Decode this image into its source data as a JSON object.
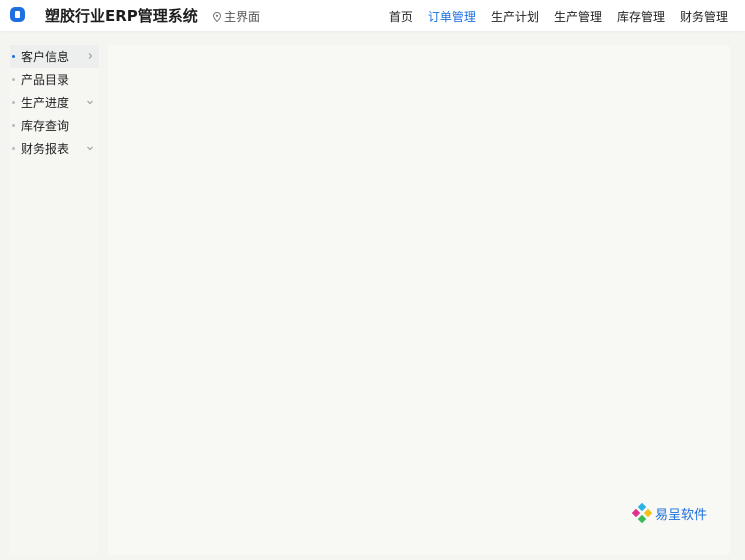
{
  "header": {
    "title": "塑胶行业ERP管理系统",
    "module_label": "主界面",
    "nav": [
      {
        "label": "首页",
        "active": false
      },
      {
        "label": "订单管理",
        "active": true
      },
      {
        "label": "生产计划",
        "active": false
      },
      {
        "label": "生产管理",
        "active": false
      },
      {
        "label": "库存管理",
        "active": false
      },
      {
        "label": "财务管理",
        "active": false
      }
    ]
  },
  "sidebar": {
    "items": [
      {
        "label": "客户信息",
        "active": true,
        "chevron": "chevron-right-icon"
      },
      {
        "label": "产品目录",
        "active": false,
        "chevron": ""
      },
      {
        "label": "生产进度",
        "active": false,
        "chevron": "chevron-down-icon"
      },
      {
        "label": "库存查询",
        "active": false,
        "chevron": ""
      },
      {
        "label": "财务报表",
        "active": false,
        "chevron": "chevron-down-icon"
      }
    ]
  },
  "brand": {
    "name": "易呈软件"
  },
  "colors": {
    "accent": "#1e6fe0",
    "background": "#f4f5f0",
    "panel": "#f8f8f5"
  }
}
